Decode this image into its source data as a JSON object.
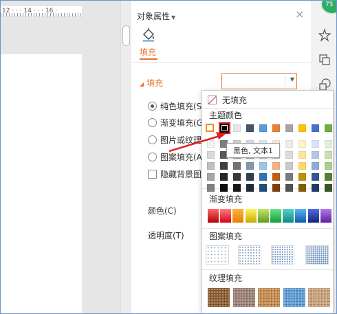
{
  "ruler": {
    "text": "12 · · · 14 · · · 16 ·"
  },
  "pane": {
    "title": "对象属性",
    "close": "×",
    "tab": "填充",
    "section": "填充",
    "options": [
      {
        "label": "纯色填充(S)",
        "selected": true
      },
      {
        "label": "渐变填充(G)",
        "selected": false
      },
      {
        "label": "图片或纹理",
        "selected": false
      },
      {
        "label": "图案填充(A)",
        "selected": false
      }
    ],
    "hide_bg": "隐藏背景图",
    "color_label": "颜色(C)",
    "transparency_label": "透明度(T)"
  },
  "toolbar": {
    "badge": "75"
  },
  "popup": {
    "no_fill": "无填充",
    "theme_title": "主题颜色",
    "tooltip": "黑色, 文本1",
    "gradient_title": "渐变填充",
    "pattern_title": "图案填充",
    "texture_title": "纹理填充"
  },
  "colors": {
    "accent": "#e8722a",
    "theme_top": [
      "#ffffff",
      "#000000",
      "#e7e6e6",
      "#44546a",
      "#5b9bd5",
      "#ed7d31",
      "#a5a5a5",
      "#ffc000",
      "#4472c4",
      "#70ad47"
    ],
    "theme_cols": [
      [
        "#f2f2f2",
        "#d9d9d9",
        "#bfbfbf",
        "#a6a6a6",
        "#808080"
      ],
      [
        "#7f7f7f",
        "#595959",
        "#404040",
        "#262626",
        "#0d0d0d"
      ],
      [
        "#d0cece",
        "#aeabab",
        "#757171",
        "#3a3838",
        "#161616"
      ],
      [
        "#d6dce4",
        "#adb9ca",
        "#8497b0",
        "#333f4f",
        "#222a35"
      ],
      [
        "#deebf6",
        "#bdd7ee",
        "#9dc3e6",
        "#2e75b5",
        "#1f4e79"
      ],
      [
        "#fbe5d5",
        "#f8cbad",
        "#f4b183",
        "#c55a11",
        "#843c0b"
      ],
      [
        "#ededed",
        "#dbdbdb",
        "#c9c9c9",
        "#7b7b7b",
        "#525252"
      ],
      [
        "#fff2cc",
        "#fee599",
        "#ffd965",
        "#bf9000",
        "#7f6000"
      ],
      [
        "#dae3f3",
        "#b4c7e7",
        "#8faadc",
        "#2f5597",
        "#203864"
      ],
      [
        "#e2efd9",
        "#c5e0b3",
        "#a8d08d",
        "#538135",
        "#375623"
      ]
    ],
    "gradients": [
      [
        "#ff6b6b",
        "#b30000"
      ],
      [
        "#ff8080",
        "#d9001b"
      ],
      [
        "#ffb347",
        "#e67e00"
      ],
      [
        "#fff566",
        "#c9a800"
      ],
      [
        "#c5e86c",
        "#5c9e1a"
      ],
      [
        "#6fe08a",
        "#0f9d3a"
      ],
      [
        "#5ad1c9",
        "#0b8a84"
      ],
      [
        "#5ab4f0",
        "#0a5fb0"
      ],
      [
        "#4f6fdc",
        "#14237a"
      ],
      [
        "#b57be8",
        "#5b1f9e"
      ]
    ],
    "textures": [
      "#8b5a2b",
      "#9a7f73",
      "#c48a4a",
      "#5b9bd5",
      "#c9a078"
    ]
  }
}
